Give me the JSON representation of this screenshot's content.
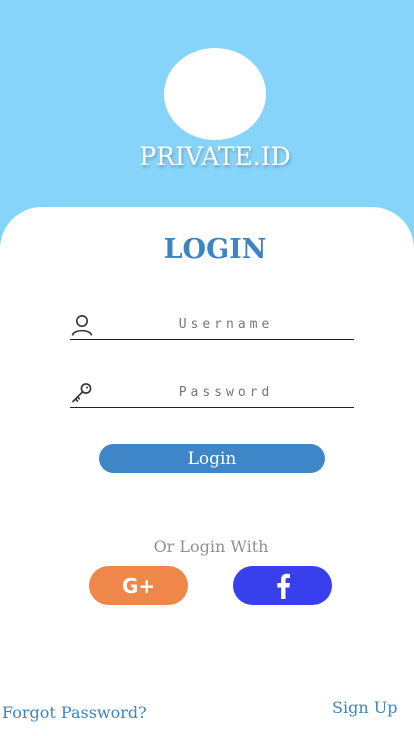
{
  "header": {
    "brand": "PRIVATE.ID"
  },
  "login": {
    "title": "LOGIN",
    "username_placeholder": "Username",
    "password_placeholder": "Password",
    "submit_label": "Login",
    "username_icon": "user-icon",
    "password_icon": "key-icon"
  },
  "social": {
    "or_text": "Or Login With",
    "google_label": "G+",
    "google_icon": "google-plus-icon",
    "facebook_icon": "facebook-icon"
  },
  "footer": {
    "forgot_label": "Forgot Password?",
    "signup_label": "Sign Up"
  },
  "colors": {
    "sky": "#87D4FB",
    "accent": "#3C85C4",
    "google": "#F0874A",
    "facebook": "#3840EE"
  }
}
